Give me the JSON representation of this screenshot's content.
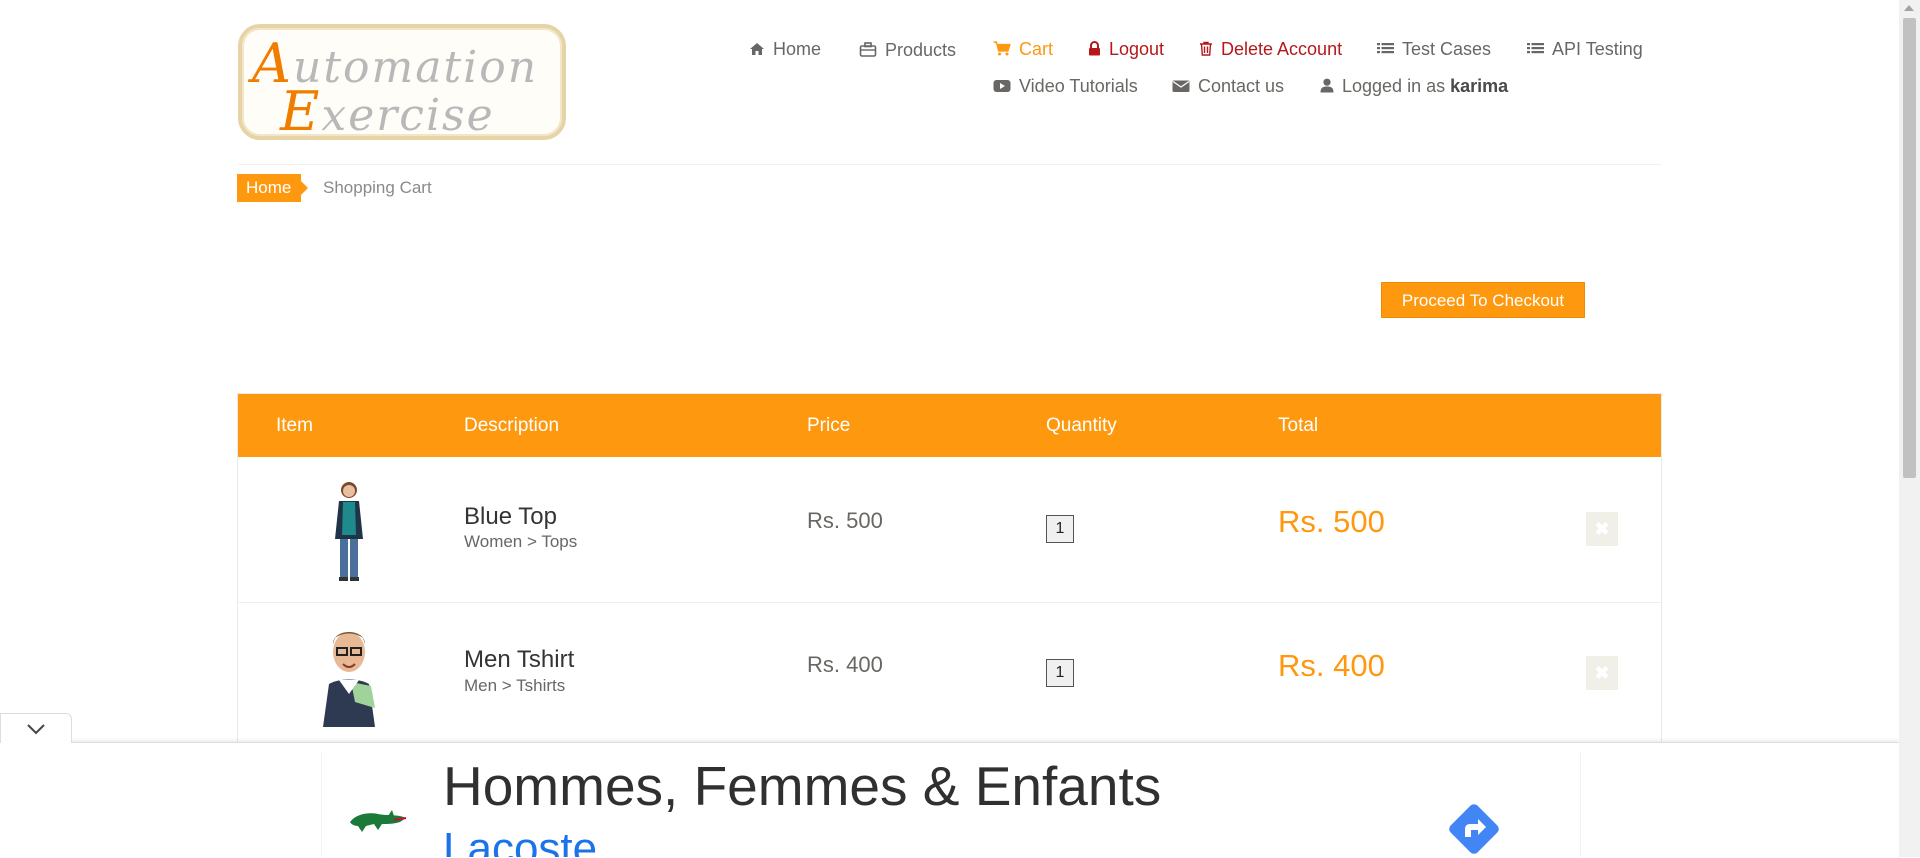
{
  "logo": {
    "line1_cap": "A",
    "line1_rest": "utomation",
    "line2_cap": "E",
    "line2_rest": "xercise"
  },
  "nav": {
    "home": "Home",
    "products": "Products",
    "cart": "Cart",
    "logout": "Logout",
    "delete_account": "Delete Account",
    "test_cases": "Test Cases",
    "api_testing": "API Testing",
    "video_tutorials": "Video Tutorials",
    "contact_us": "Contact us",
    "logged_in_prefix": "Logged in as",
    "username": "karima"
  },
  "breadcrumb": {
    "home": "Home",
    "current": "Shopping Cart"
  },
  "checkout_button": "Proceed To Checkout",
  "table": {
    "headers": {
      "item": "Item",
      "description": "Description",
      "price": "Price",
      "quantity": "Quantity",
      "total": "Total"
    },
    "rows": [
      {
        "name": "Blue Top",
        "category": "Women > Tops",
        "price": "Rs. 500",
        "quantity": "1",
        "total": "Rs. 500",
        "delete_icon": "close-icon"
      },
      {
        "name": "Men Tshirt",
        "category": "Men > Tshirts",
        "price": "Rs. 400",
        "quantity": "1",
        "total": "Rs. 400",
        "delete_icon": "close-icon"
      }
    ]
  },
  "ad": {
    "headline": "Hommes, Femmes & Enfants",
    "brand": "Lacoste"
  },
  "colors": {
    "accent": "#fe980f",
    "danger": "#b4181a",
    "text": "#696763",
    "link_blue": "#1a73e8"
  }
}
